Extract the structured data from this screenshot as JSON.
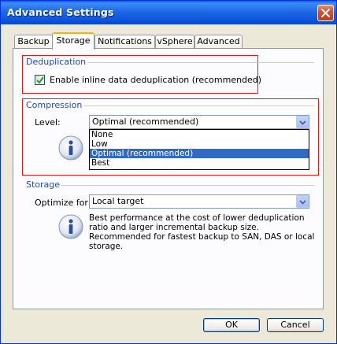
{
  "window": {
    "title": "Advanced Settings"
  },
  "tabs": [
    {
      "label": "Backup",
      "active": false
    },
    {
      "label": "Storage",
      "active": true
    },
    {
      "label": "Notifications",
      "active": false
    },
    {
      "label": "vSphere",
      "active": false
    },
    {
      "label": "Advanced",
      "active": false
    }
  ],
  "deduplication": {
    "title": "Deduplication",
    "checkbox_label": "Enable inline data deduplication (recommended)",
    "checked": true
  },
  "compression": {
    "title": "Compression",
    "level_label": "Level:",
    "level_value": "Optimal (recommended)",
    "options": [
      "None",
      "Low",
      "Optimal (recommended)",
      "Best"
    ],
    "selected_index": 2
  },
  "storage": {
    "title": "Storage",
    "optimize_label": "Optimize for:",
    "optimize_value": "Local target",
    "description": "Best performance at the cost of lower deduplication ratio and larger incremental backup size. Recommended for fastest backup to SAN, DAS or local storage."
  },
  "buttons": {
    "ok": "OK",
    "cancel": "Cancel"
  },
  "colors": {
    "accent": "#316ac5",
    "group_title": "#1f4bbf",
    "highlight_box": "#e11919"
  },
  "icons": [
    "close-icon",
    "checkmark-icon",
    "chevron-down-icon",
    "info-icon"
  ]
}
